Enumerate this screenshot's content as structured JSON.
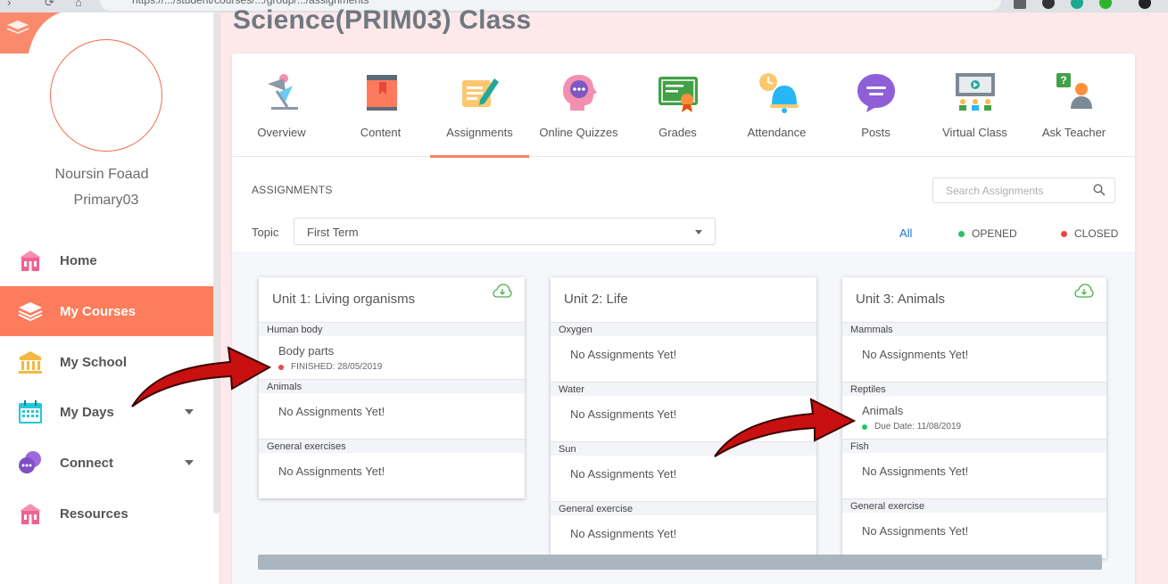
{
  "browser": {
    "url": "https://.../student/courses/.../group/.../assignments"
  },
  "sidebar": {
    "user_name": "Noursin Foaad",
    "user_class": "Primary03",
    "items": [
      {
        "label": "Home",
        "icon": "school-building-icon",
        "active": false
      },
      {
        "label": "My Courses",
        "icon": "layers-icon",
        "active": true
      },
      {
        "label": "My School",
        "icon": "institution-icon",
        "active": false
      },
      {
        "label": "My Days",
        "icon": "calendar-icon",
        "active": false,
        "has_caret": true
      },
      {
        "label": "Connect",
        "icon": "chat-icon",
        "active": false,
        "has_caret": true
      },
      {
        "label": "Resources",
        "icon": "library-building-icon",
        "active": false
      }
    ]
  },
  "page": {
    "title": "Science(PRIM03) Class"
  },
  "tabs": [
    {
      "label": "Overview",
      "icon": "desk-lamp-icon"
    },
    {
      "label": "Content",
      "icon": "book-icon"
    },
    {
      "label": "Assignments",
      "icon": "assignment-pen-icon",
      "active": true
    },
    {
      "label": "Online Quizzes",
      "icon": "head-thinking-icon"
    },
    {
      "label": "Grades",
      "icon": "certificate-icon"
    },
    {
      "label": "Attendance",
      "icon": "bell-clock-icon"
    },
    {
      "label": "Posts",
      "icon": "speech-bubble-icon"
    },
    {
      "label": "Virtual Class",
      "icon": "presentation-board-icon"
    },
    {
      "label": "Ask Teacher",
      "icon": "question-person-icon"
    }
  ],
  "assignments": {
    "section_title": "ASSIGNMENTS",
    "search_placeholder": "Search Assignments",
    "topic_label": "Topic",
    "topic_value": "First Term",
    "filters": {
      "all": "All",
      "opened": "OPENED",
      "closed": "CLOSED"
    }
  },
  "colors": {
    "accent": "#fd7c5b",
    "opened": "#22c55e",
    "closed": "#ef4444",
    "link": "#1976d2"
  },
  "units": [
    {
      "title": "Unit 1: Living organisms",
      "downloadable": true,
      "topics": [
        {
          "name": "Human body",
          "assignment": {
            "name": "Body parts",
            "status": "FINISHED: 28/05/2019",
            "state": "closed"
          }
        },
        {
          "name": "Animals",
          "empty": "No Assignments Yet!"
        },
        {
          "name": "General exercises",
          "empty": "No Assignments Yet!"
        }
      ]
    },
    {
      "title": "Unit 2: Life",
      "downloadable": false,
      "topics": [
        {
          "name": "Oxygen",
          "empty": "No Assignments Yet!"
        },
        {
          "name": "Water",
          "empty": "No Assignments Yet!"
        },
        {
          "name": "Sun",
          "empty": "No Assignments Yet!"
        },
        {
          "name": "General exercise",
          "empty": "No Assignments Yet!"
        }
      ]
    },
    {
      "title": "Unit 3: Animals",
      "downloadable": true,
      "topics": [
        {
          "name": "Mammals",
          "empty": "No Assignments Yet!"
        },
        {
          "name": "Reptiles",
          "assignment": {
            "name": "Animals",
            "status": "Due Date: 11/08/2019",
            "state": "opened"
          }
        },
        {
          "name": "Fish",
          "empty": "No Assignments Yet!"
        },
        {
          "name": "General exercise",
          "empty": "No Assignments Yet!"
        }
      ]
    }
  ]
}
